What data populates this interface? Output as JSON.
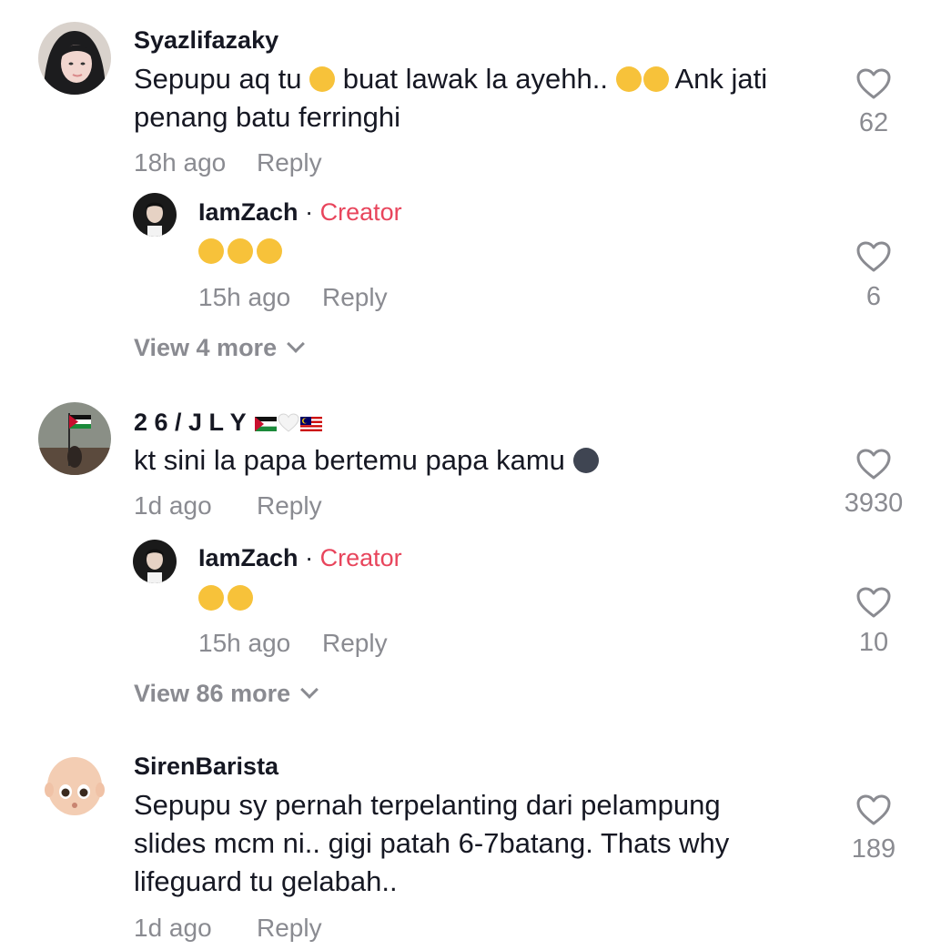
{
  "comments": [
    {
      "username": "Syazlifazaky",
      "text_line1_a": "Sepupu aq tu",
      "text_line1_b": "buat lawak la ayehh..",
      "text_line1_c": "Ank jati",
      "text_line2": "penang batu ferringhi",
      "time": "18h ago",
      "reply_label": "Reply",
      "likes": "62",
      "reply": {
        "username": "IamZach",
        "separator": "·",
        "badge": "Creator",
        "time": "15h ago",
        "reply_label": "Reply",
        "likes": "6"
      },
      "view_more": "View 4 more"
    },
    {
      "username": "2 6 / J L Y",
      "text": "kt sini la papa bertemu papa kamu",
      "time": "1d ago",
      "reply_label": "Reply",
      "likes": "3930",
      "reply": {
        "username": "IamZach",
        "separator": "·",
        "badge": "Creator",
        "time": "15h ago",
        "reply_label": "Reply",
        "likes": "10"
      },
      "view_more": "View 86 more"
    },
    {
      "username": "SirenBarista",
      "text_line1": "Sepupu sy pernah terpelanting dari pelampung",
      "text_line2": "slides mcm ni.. gigi patah 6-7batang. Thats why",
      "text_line3": "lifeguard tu gelabah..",
      "time": "1d ago",
      "reply_label": "Reply",
      "likes": "189"
    }
  ],
  "colors": {
    "creator_badge": "#e8455c",
    "secondary_text": "#8a8b91",
    "primary_text": "#161823"
  },
  "icons": [
    "heart-outline-icon",
    "chevron-down-icon",
    "rolling-laughing-emoji",
    "tears-of-joy-emoji",
    "flushed-face-emoji",
    "new-moon-face-emoji",
    "palestine-flag",
    "white-heart",
    "malaysia-flag"
  ]
}
